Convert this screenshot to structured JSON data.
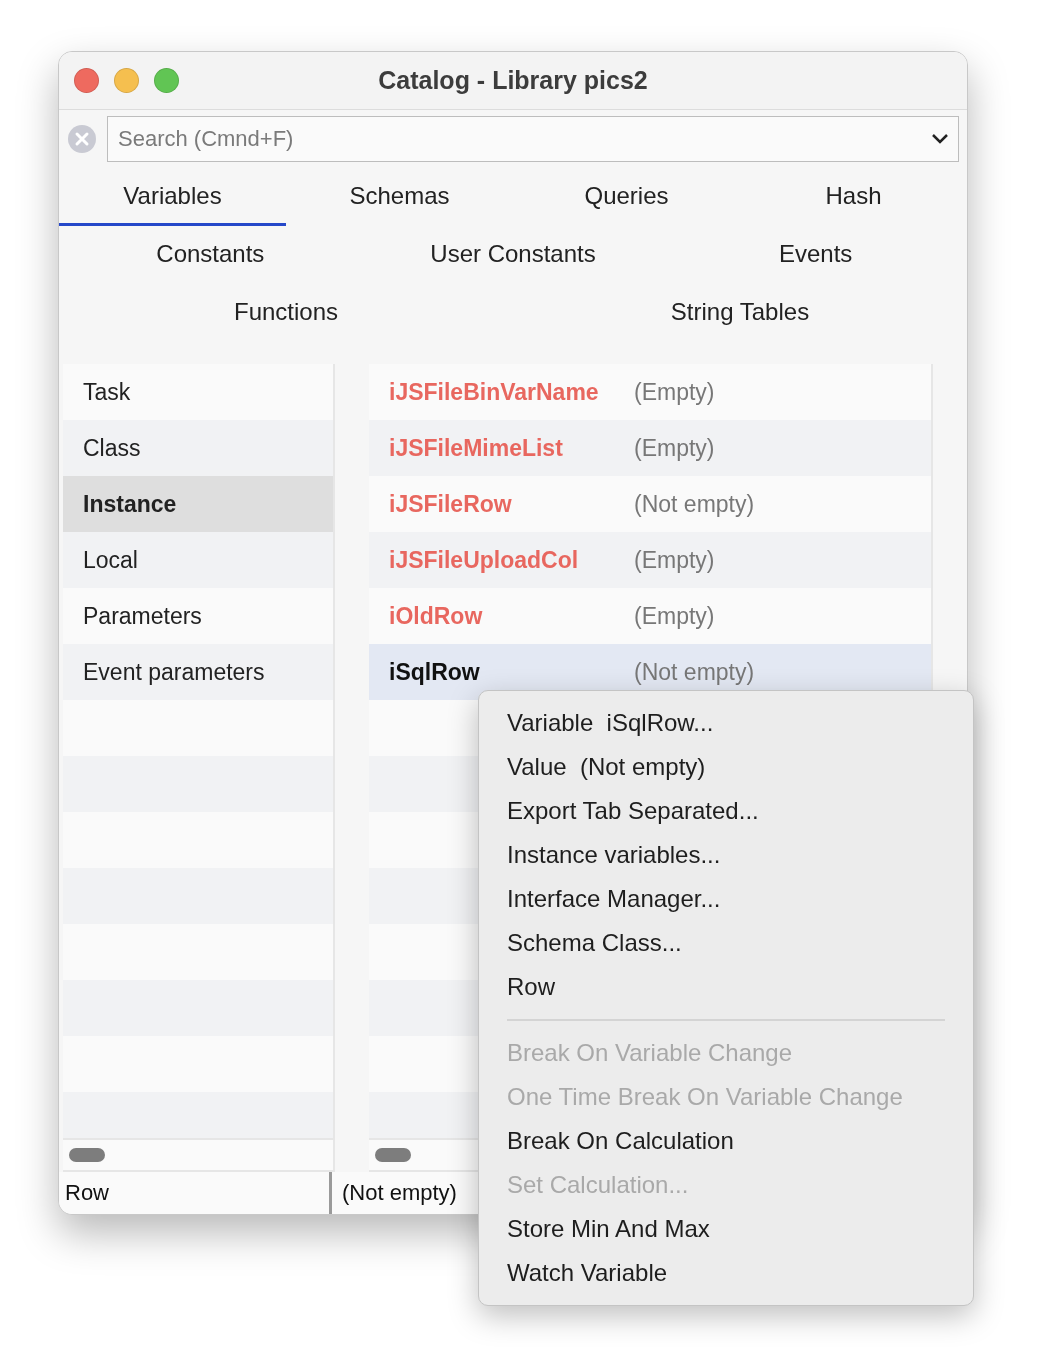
{
  "window": {
    "title": "Catalog - Library pics2"
  },
  "search": {
    "placeholder": "Search (Cmnd+F)"
  },
  "tab_rows": [
    [
      {
        "label": "Variables",
        "selected": true
      },
      {
        "label": "Schemas",
        "selected": false
      },
      {
        "label": "Queries",
        "selected": false
      },
      {
        "label": "Hash",
        "selected": false
      }
    ],
    [
      {
        "label": "Constants",
        "selected": false
      },
      {
        "label": "User Constants",
        "selected": false
      },
      {
        "label": "Events",
        "selected": false
      }
    ],
    [
      {
        "label": "Functions",
        "selected": false
      },
      {
        "label": "String Tables",
        "selected": false
      }
    ]
  ],
  "sidebar": {
    "items": [
      {
        "label": "Task",
        "selected": false
      },
      {
        "label": "Class",
        "selected": false
      },
      {
        "label": "Instance",
        "selected": true
      },
      {
        "label": "Local",
        "selected": false
      },
      {
        "label": "Parameters",
        "selected": false
      },
      {
        "label": "Event parameters",
        "selected": false
      }
    ]
  },
  "variables": [
    {
      "name": "iJSFileBinVarName",
      "value": "(Empty)",
      "selected": false
    },
    {
      "name": "iJSFileMimeList",
      "value": "(Empty)",
      "selected": false
    },
    {
      "name": "iJSFileRow",
      "value": "(Not empty)",
      "selected": false
    },
    {
      "name": "iJSFileUploadCol",
      "value": "(Empty)",
      "selected": false
    },
    {
      "name": "iOldRow",
      "value": "(Empty)",
      "selected": false
    },
    {
      "name": "iSqlRow",
      "value": "(Not empty)",
      "selected": true
    }
  ],
  "status_bar": {
    "name": "Row",
    "value": "(Not empty)"
  },
  "context_menu": [
    {
      "kind": "item",
      "label": "Variable  iSqlRow...",
      "disabled": false
    },
    {
      "kind": "item",
      "label": "Value  (Not empty)",
      "disabled": false
    },
    {
      "kind": "item",
      "label": "Export Tab Separated...",
      "disabled": false
    },
    {
      "kind": "item",
      "label": "Instance variables...",
      "disabled": false
    },
    {
      "kind": "item",
      "label": "Interface Manager...",
      "disabled": false
    },
    {
      "kind": "item",
      "label": "Schema Class...",
      "disabled": false
    },
    {
      "kind": "item",
      "label": "Row",
      "disabled": false
    },
    {
      "kind": "separator"
    },
    {
      "kind": "item",
      "label": "Break On Variable Change",
      "disabled": true
    },
    {
      "kind": "item",
      "label": "One Time Break On Variable Change",
      "disabled": true
    },
    {
      "kind": "item",
      "label": "Break On Calculation",
      "disabled": false
    },
    {
      "kind": "item",
      "label": "Set Calculation...",
      "disabled": true
    },
    {
      "kind": "item",
      "label": "Store Min And Max",
      "disabled": false
    },
    {
      "kind": "item",
      "label": "Watch Variable",
      "disabled": false
    }
  ]
}
